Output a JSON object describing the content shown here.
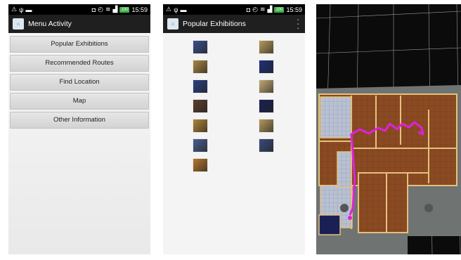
{
  "phone1": {
    "status": {
      "time": "15:59",
      "battery": "100"
    },
    "title": "Menu Activity",
    "menu": [
      "Popular Exhibitions",
      "Recommended Routes",
      "Find Location",
      "Map",
      "Other Information"
    ]
  },
  "phone2": {
    "status": {
      "time": "15:59",
      "battery": "100"
    },
    "title": "Popular Exhibitions",
    "thumbnails": [
      {
        "tone": "#3b4e8c"
      },
      {
        "tone": "#b89a5a"
      },
      {
        "tone": "#a88640"
      },
      {
        "tone": "#1e2f7a"
      },
      {
        "tone": "#2c3f82"
      },
      {
        "tone": "#c2aa74"
      },
      {
        "tone": "#5a3f2e"
      },
      {
        "tone": "#1a1f55"
      },
      {
        "tone": "#b08536"
      },
      {
        "tone": "#b4995c"
      },
      {
        "tone": "#4a5f8e"
      },
      {
        "tone": "#3b4a78"
      },
      {
        "tone": "#b5772a"
      }
    ]
  },
  "map": {
    "route_color": "#e020e0",
    "floor_color": "#8a4a22",
    "wall_color": "#e3c27f"
  }
}
